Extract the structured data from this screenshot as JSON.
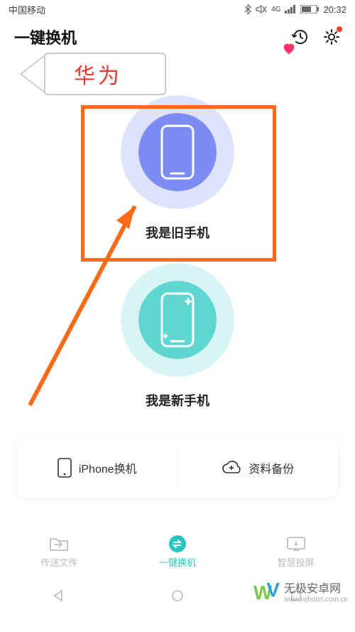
{
  "status": {
    "carrier": "中国移动",
    "network": "4G",
    "time": "20:32"
  },
  "header": {
    "title": "一键换机",
    "history_icon": "history-icon",
    "settings_icon": "gear-icon"
  },
  "callout": {
    "text": "华为"
  },
  "options": {
    "old_phone": {
      "label": "我是旧手机"
    },
    "new_phone": {
      "label": "我是新手机"
    }
  },
  "card": {
    "iphone": "iPhone换机",
    "backup": "资料备份"
  },
  "tabs": {
    "send": "传送文件",
    "switch": "一键换机",
    "cast": "智慧投屏"
  },
  "watermark": {
    "brand_left": "W",
    "brand_right": "V",
    "text": "无极安卓网",
    "url": "www.wjhotel.com.cn"
  }
}
